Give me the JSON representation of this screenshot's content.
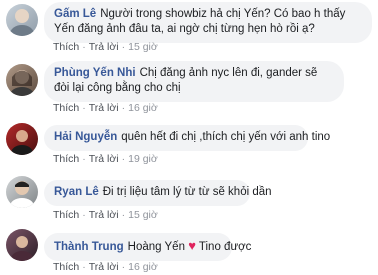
{
  "comments": [
    {
      "author": "Gấm Lê",
      "text": "Người trong showbiz hả chị Yến? Có bao h thấy Yến đăng ảnh đâu ta, ai ngờ chị từng hẹn hò rồi ạ?",
      "like": "Thích",
      "reply": "Trả lời",
      "time": "15 giờ",
      "avatar_color": "#b7c2cc"
    },
    {
      "author": "Phùng Yến Nhi",
      "text": "Chị đăng ảnh nyc lên đi, gander sẽ đòi lại công bằng cho chị",
      "like": "Thích",
      "reply": "Trả lời",
      "time": "16 giờ",
      "avatar_color": "#8e7a6a"
    },
    {
      "author": "Hải Nguyễn",
      "text": "quên hết đi chị ,thích chị yến với anh tino",
      "like": "Thích",
      "reply": "Trả lời",
      "time": "19 giờ",
      "avatar_color": "#8a1f1f"
    },
    {
      "author": "Ryan Lê",
      "text": "Đi trị liệu tâm lý từ từ sẽ khỏi dần",
      "like": "Thích",
      "reply": "Trả lời",
      "time": "15 giờ",
      "avatar_color": "#a9acae"
    },
    {
      "author": "Thành Trung",
      "text_before": "Hoàng Yến",
      "heart": "♥",
      "text_after": "Tino được",
      "like": "Thích",
      "reply": "Trả lời",
      "time": "16 giờ",
      "avatar_color": "#5c3d4f"
    }
  ]
}
